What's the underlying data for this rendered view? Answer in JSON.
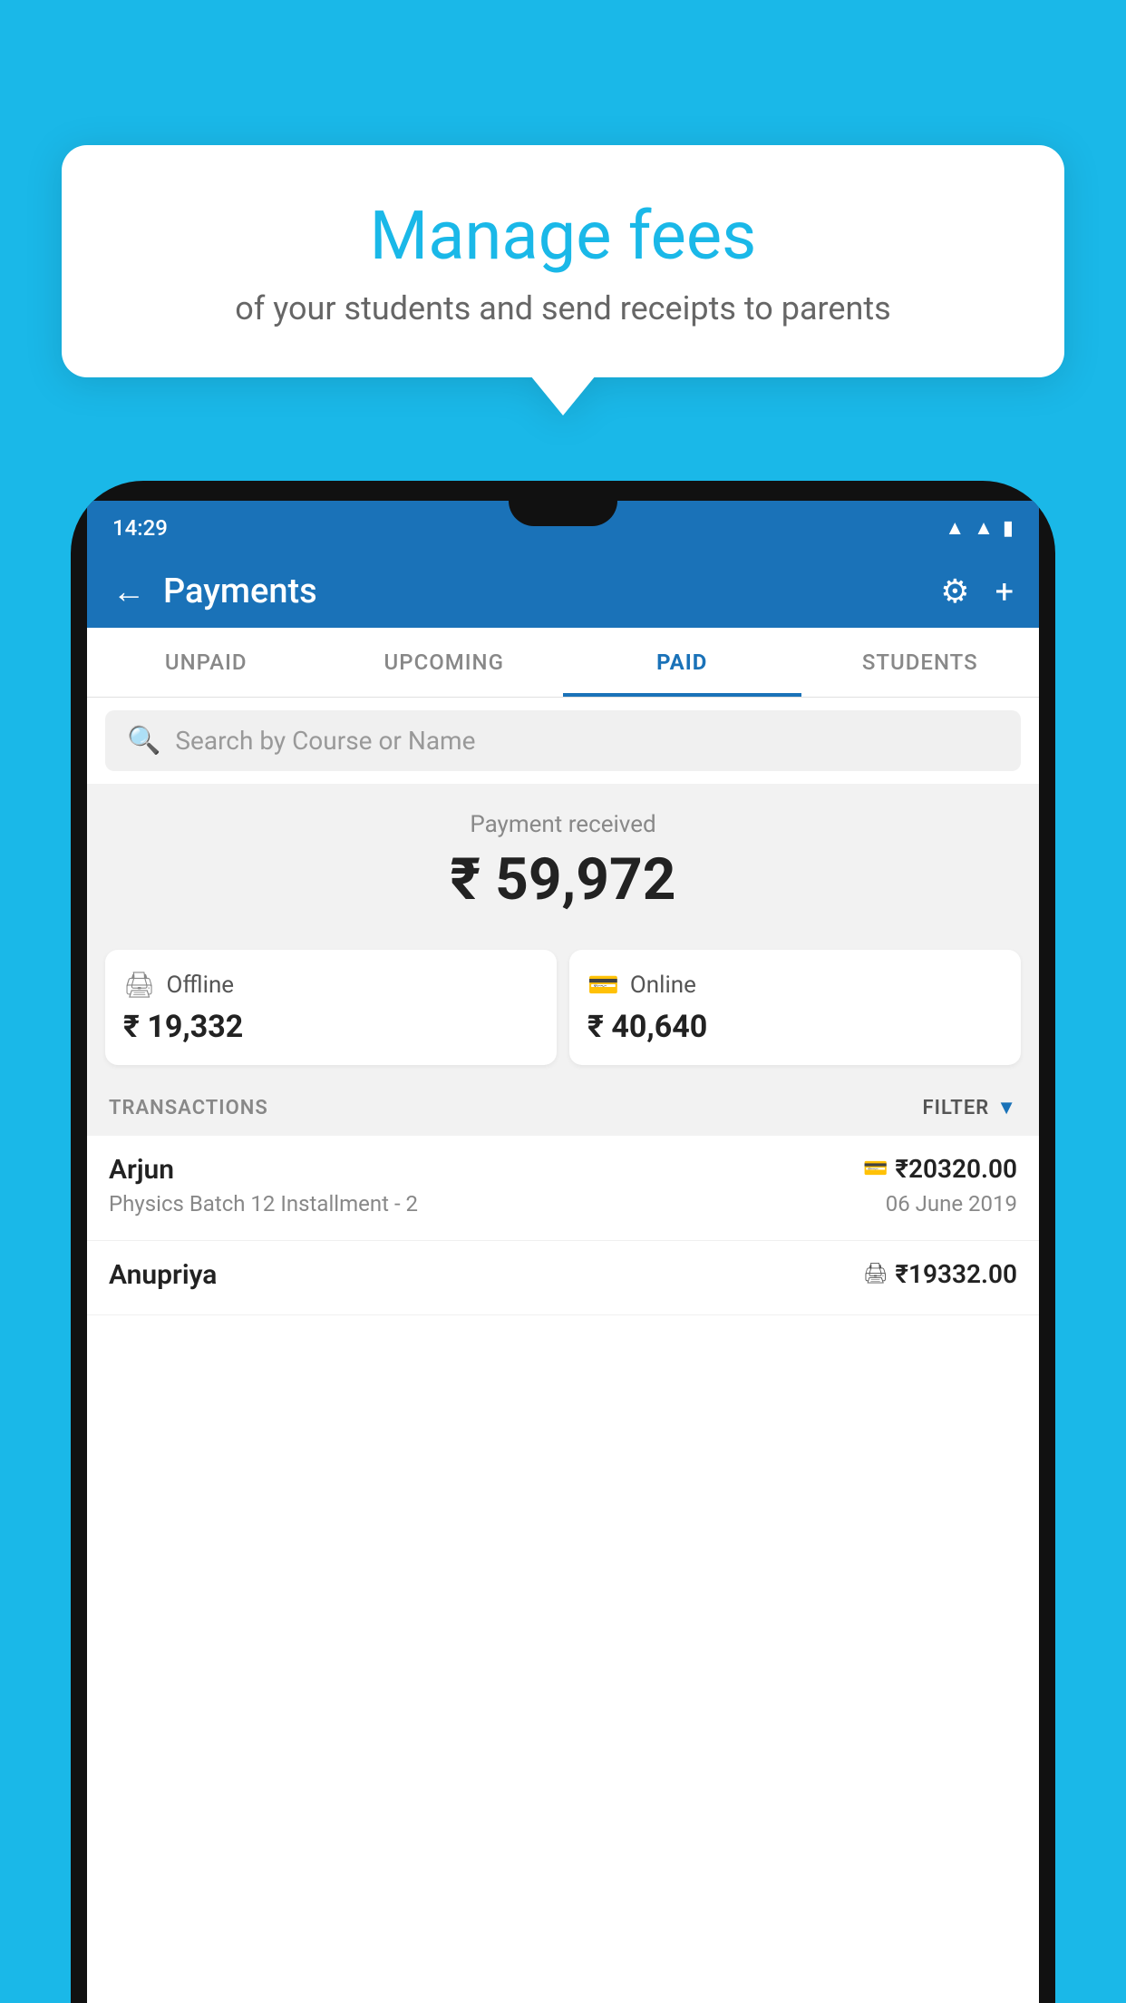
{
  "background_color": "#1ab8e8",
  "speech_bubble": {
    "title": "Manage fees",
    "subtitle": "of your students and send receipts to parents"
  },
  "phone": {
    "status_bar": {
      "time": "14:29",
      "icons": [
        "wifi",
        "signal",
        "battery"
      ]
    },
    "header": {
      "title": "Payments",
      "back_label": "←",
      "settings_label": "⚙",
      "add_label": "+"
    },
    "tabs": [
      {
        "label": "UNPAID",
        "active": false
      },
      {
        "label": "UPCOMING",
        "active": false
      },
      {
        "label": "PAID",
        "active": true
      },
      {
        "label": "STUDENTS",
        "active": false
      }
    ],
    "search": {
      "placeholder": "Search by Course or Name"
    },
    "payment_summary": {
      "label": "Payment received",
      "amount": "₹ 59,972",
      "offline": {
        "label": "Offline",
        "amount": "₹ 19,332"
      },
      "online": {
        "label": "Online",
        "amount": "₹ 40,640"
      }
    },
    "transactions": {
      "section_label": "TRANSACTIONS",
      "filter_label": "FILTER",
      "items": [
        {
          "name": "Arjun",
          "course": "Physics Batch 12 Installment - 2",
          "amount": "₹20320.00",
          "date": "06 June 2019",
          "type": "online"
        },
        {
          "name": "Anupriya",
          "course": "",
          "amount": "₹19332.00",
          "date": "",
          "type": "offline"
        }
      ]
    }
  }
}
